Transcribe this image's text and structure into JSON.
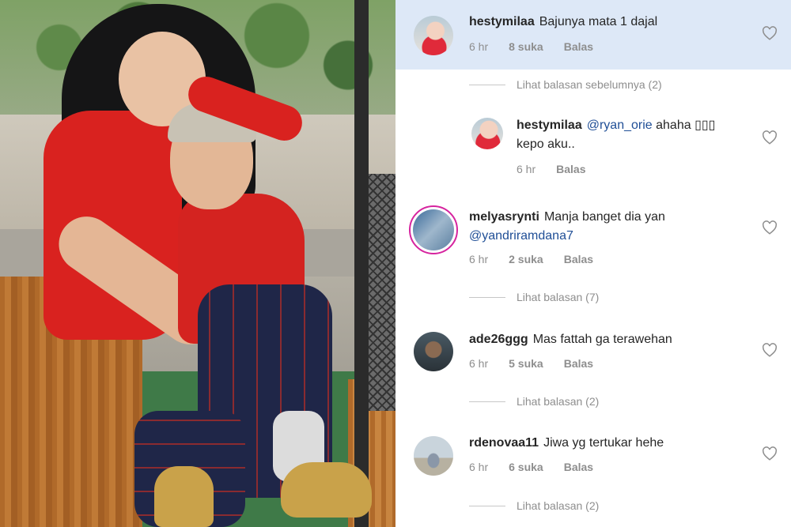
{
  "comments": [
    {
      "username": "hestymilaa",
      "text": "Bajunya mata 1 dajal",
      "time": "6 hr",
      "likes": "8 suka",
      "reply": "Balas",
      "highlighted": true
    },
    {
      "username": "hestymilaa",
      "mention": "@ryan_orie",
      "text": "ahaha ▯▯▯",
      "text2": "kepo aku..",
      "time": "6 hr",
      "reply": "Balas",
      "is_reply": true
    },
    {
      "username": "melyasrynti",
      "text": "Manja banget dia yan",
      "mention": "@yandriramdana7",
      "time": "6 hr",
      "likes": "2 suka",
      "reply": "Balas"
    },
    {
      "username": "ade26ggg",
      "text": "Mas fattah ga terawehan",
      "time": "6 hr",
      "likes": "5 suka",
      "reply": "Balas"
    },
    {
      "username": "rdenovaa11",
      "text": "Jiwa yg tertukar hehe",
      "time": "6 hr",
      "likes": "6 suka",
      "reply": "Balas"
    }
  ],
  "view_replies": {
    "previous": "Lihat balasan sebelumnya (2)",
    "melyasrynti": "Lihat balasan (7)",
    "ade26ggg": "Lihat balasan (2)",
    "rdenovaa11": "Lihat balasan (2)"
  },
  "colors": {
    "highlight_bg": "#dde8f7",
    "mention": "#1f4e96",
    "meta_text": "#8e8e8e",
    "story_ring": "#d6249f"
  },
  "icons": {
    "like": "heart-outline-icon"
  }
}
